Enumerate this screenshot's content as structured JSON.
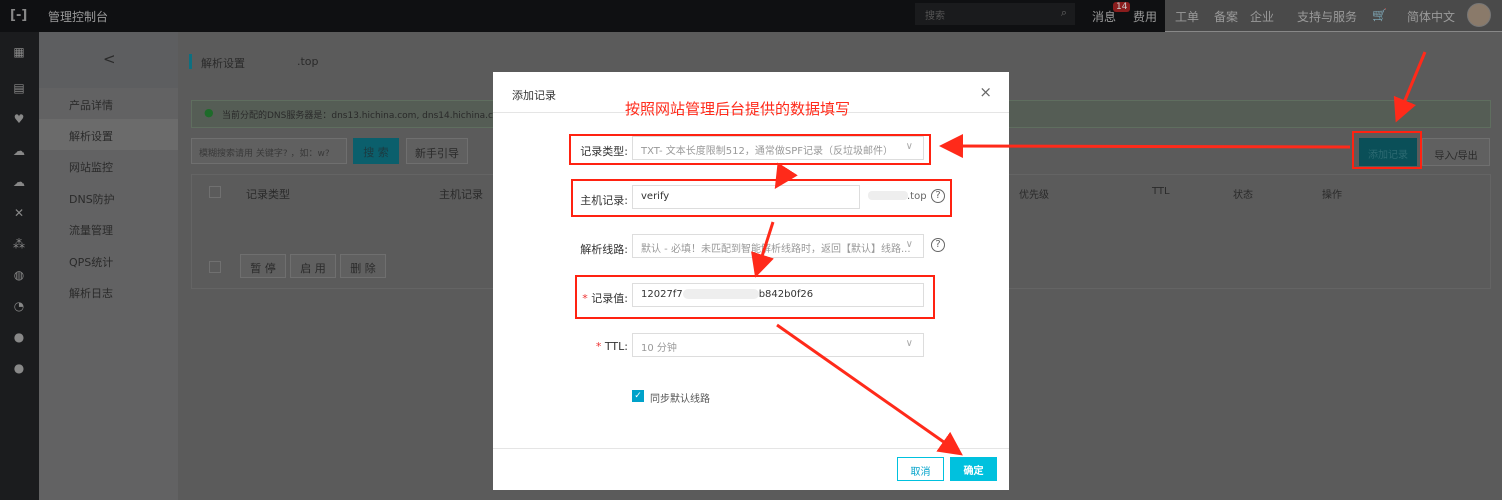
{
  "topbar": {
    "title": "管理控制台",
    "search_placeholder": "搜索",
    "messages": "消息",
    "badge": "14",
    "fees": "费用",
    "items": [
      "工单",
      "备案",
      "企业",
      "支持与服务"
    ],
    "language": "简体中文"
  },
  "sidebar": {
    "back": "<",
    "items": [
      "产品详情",
      "解析设置",
      "网站监控",
      "DNS防护",
      "流量管理",
      "QPS统计",
      "解析日志"
    ]
  },
  "page": {
    "title": "解析设置",
    "domain_suffix": ".top",
    "notice": "当前分配的DNS服务器是：dns13.hichina.com, dns14.hichina.com",
    "search_placeholder": "模糊搜索请用 关键字? ，如：w?",
    "search_button": "搜 索",
    "guide_button": "新手引导",
    "add_record": "添加记录",
    "import_export": "导入/导出",
    "columns": [
      "记录类型",
      "主机记录",
      "优先级",
      "TTL",
      "状态",
      "操作"
    ],
    "bulk": [
      "暂 停",
      "启 用",
      "删 除"
    ]
  },
  "modal": {
    "title": "添加记录",
    "close": "×",
    "annotation": "按照网站管理后台提供的数据填写",
    "record_type_label": "记录类型:",
    "record_type_value": "TXT- 文本长度限制512，通常做SPF记录（反垃圾邮件）",
    "host_label": "主机记录:",
    "host_value": "verify",
    "host_suffix": ".top",
    "line_label": "解析线路:",
    "line_value": "默认 - 必填！未匹配到智能解析线路时，返回【默认】线路...",
    "value_label": "记录值:",
    "value_prefix": "12027f7",
    "value_suffix": "b842b0f26",
    "ttl_label": "TTL:",
    "ttl_value": "10 分钟",
    "sync_label": "同步默认线路",
    "sync_checked": true,
    "cancel": "取消",
    "confirm": "确定"
  },
  "colors": {
    "accent": "#00c1de",
    "annotation": "#ff2a1a"
  }
}
